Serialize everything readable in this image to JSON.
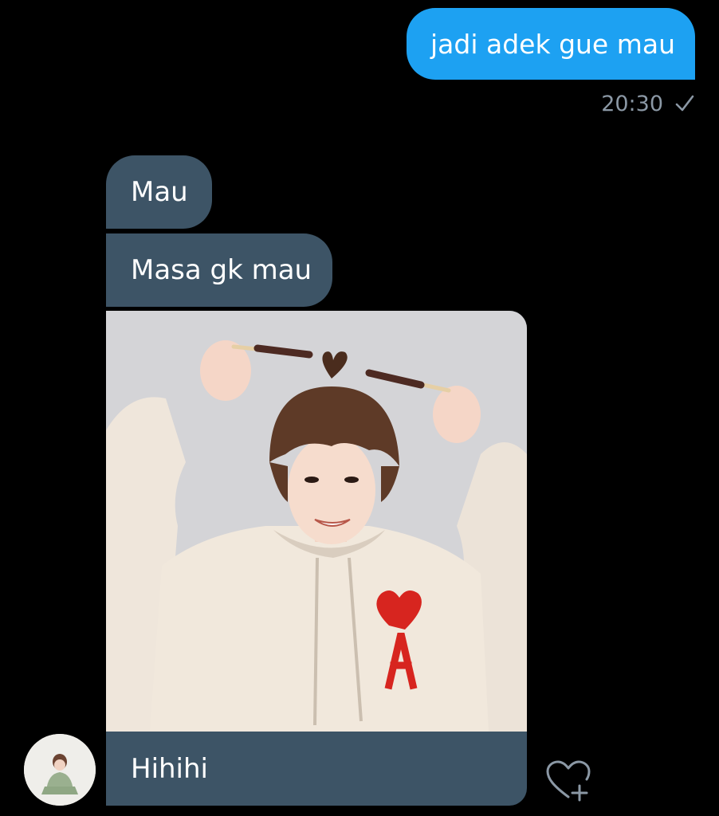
{
  "messages": {
    "sent": [
      {
        "text": "jadi adek gue mau",
        "time": "20:30"
      }
    ],
    "received": [
      {
        "text": "Mau"
      },
      {
        "text": "Masa gk mau"
      },
      {
        "text": "Hihihi"
      }
    ]
  },
  "icons": {
    "read_receipt": "checkmark-icon",
    "reaction": "heart-plus-icon",
    "photo": "photo-of-person-in-hoodie",
    "avatar": "contact-avatar"
  },
  "colors": {
    "background": "#000000",
    "sent_bubble": "#1da1f2",
    "received_bubble": "#3d5466",
    "timestamp": "#8b98a5"
  }
}
